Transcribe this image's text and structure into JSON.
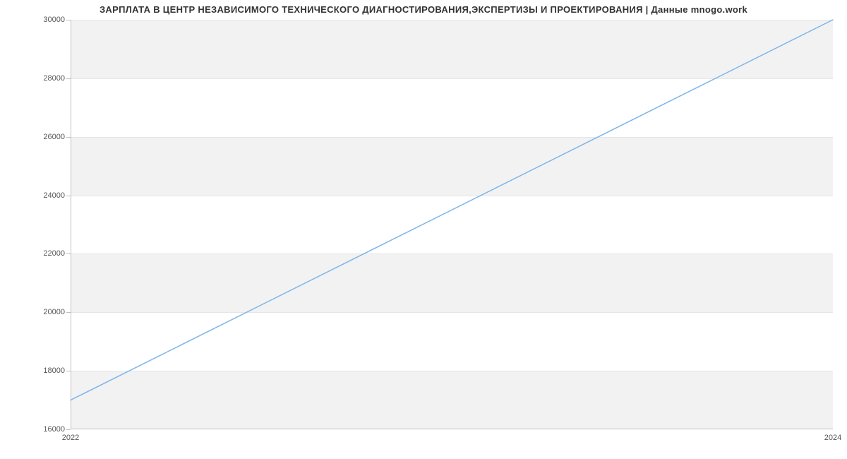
{
  "chart_data": {
    "type": "line",
    "title": "ЗАРПЛАТА В ЦЕНТР НЕЗАВИСИМОГО ТЕХНИЧЕСКОГО ДИАГНОСТИРОВАНИЯ,ЭКСПЕРТИЗЫ И ПРОЕКТИРОВАНИЯ | Данные mnogo.work",
    "x": [
      2022,
      2024
    ],
    "values": [
      17000,
      30000
    ],
    "xlabel": "",
    "ylabel": "",
    "x_ticks": [
      2022,
      2024
    ],
    "y_ticks": [
      16000,
      18000,
      20000,
      22000,
      24000,
      26000,
      28000,
      30000
    ],
    "xlim": [
      2022,
      2024
    ],
    "ylim": [
      16000,
      30000
    ],
    "line_color": "#7cb5ec",
    "band_color": "#f2f2f2"
  }
}
